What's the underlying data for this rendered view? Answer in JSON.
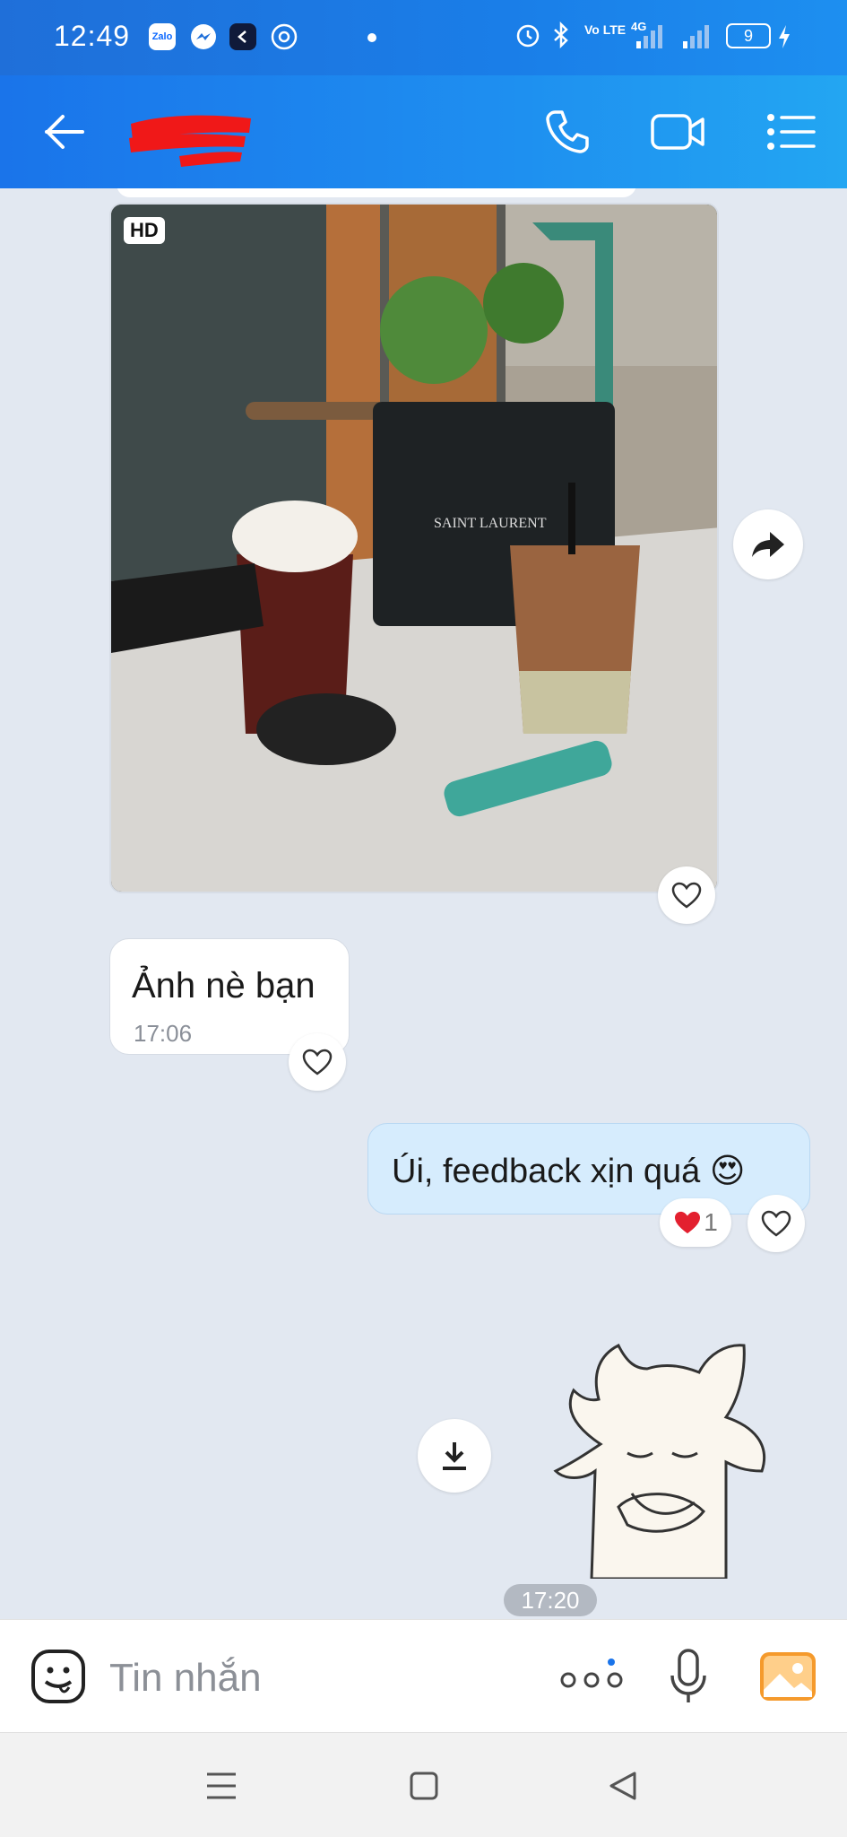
{
  "status_bar": {
    "time": "12:49",
    "app_icons": [
      "zalo-icon",
      "messenger-icon",
      "app-icon",
      "chrome-icon"
    ],
    "right_icons": [
      "alarm-icon",
      "bluetooth-icon",
      "volte-icon",
      "signal-4g-icon",
      "signal-icon",
      "battery-icon"
    ],
    "volte_label": "Vo LTE",
    "network_label": "4G",
    "battery_level": "9",
    "zalo_label": "Zalo"
  },
  "header": {
    "contact_name": "",
    "actions": [
      "phone-icon",
      "video-icon",
      "menu-icon"
    ]
  },
  "chat": {
    "photo_badge": "HD",
    "messages": [
      {
        "direction": "in",
        "text": "Ảnh nè bạn",
        "time": "17:06"
      },
      {
        "direction": "out",
        "text": "Úi, feedback xịn quá",
        "emoji": "😍",
        "reaction_count": "1"
      }
    ],
    "sticker_time": "17:20"
  },
  "input_bar": {
    "placeholder": "Tin nhắn"
  },
  "colors": {
    "header_blue": "#1a74ea",
    "chat_bg": "#e2e8f1",
    "outgoing_bubble": "#d6ecfd",
    "reaction_heart": "#e3202f"
  }
}
